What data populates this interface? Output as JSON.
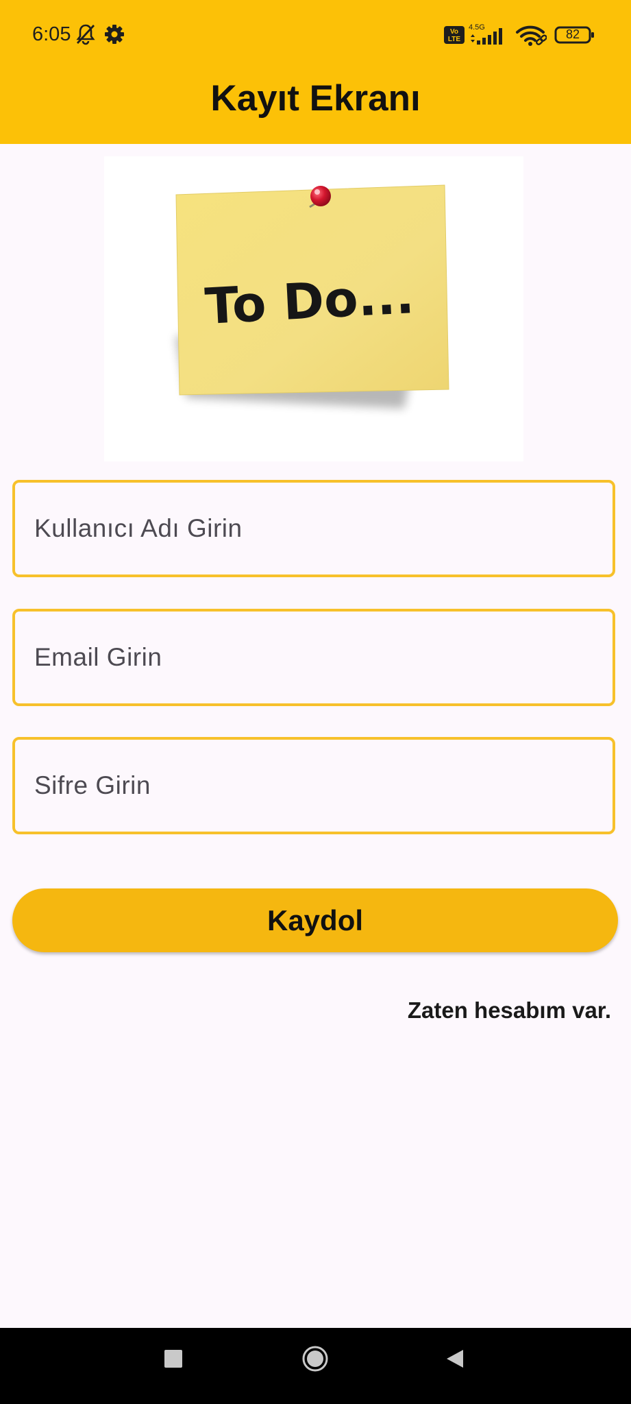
{
  "status_bar": {
    "time": "6:05",
    "network": "4.5G",
    "volte": "Vo LTE",
    "battery": "82",
    "icons": [
      "bell-off-icon",
      "settings-gear-icon",
      "signal-bars-icon",
      "wifi-icon",
      "battery-icon"
    ]
  },
  "app_bar": {
    "title": "Kayıt Ekranı"
  },
  "hero": {
    "note_text": "To Do..."
  },
  "form": {
    "username_placeholder": "Kullanıcı Adı Girin",
    "email_placeholder": "Email Girin",
    "password_placeholder": "Sifre Girin"
  },
  "actions": {
    "register_label": "Kaydol",
    "login_link": "Zaten hesabım var."
  },
  "nav": {
    "icons": [
      "recents-square-icon",
      "home-circle-icon",
      "back-triangle-icon"
    ]
  },
  "colors": {
    "app_bar": "#fcc107",
    "field_border": "#f7c12b",
    "button": "#f5b710",
    "background": "#fdf8fd"
  }
}
